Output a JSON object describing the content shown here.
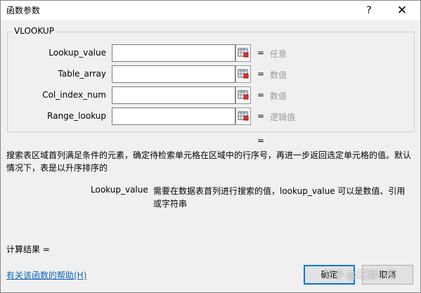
{
  "window": {
    "title": "函数参数",
    "help_label": "?",
    "close_label": "✕"
  },
  "group": {
    "function_name": "VLOOKUP",
    "params": [
      {
        "label": "Lookup_value",
        "value": "",
        "equals": "=",
        "hint": "任意"
      },
      {
        "label": "Table_array",
        "value": "",
        "equals": "=",
        "hint": "数值"
      },
      {
        "label": "Col_index_num",
        "value": "",
        "equals": "=",
        "hint": "数值"
      },
      {
        "label": "Range_lookup",
        "value": "",
        "equals": "=",
        "hint": "逻辑值"
      }
    ]
  },
  "result_equals": "=",
  "description": "搜索表区域首列满足条件的元素，确定待检索单元格在区域中的行序号，再进一步返回选定单元格的值。默认情况下，表是以升序排序的",
  "argument_help": {
    "name": "Lookup_value",
    "text": "需要在数据表首列进行搜索的值，lookup_value 可以是数值、引用或字符串"
  },
  "calc_result_label": "计算结果 =",
  "help_link": "有关该函数的帮助(H)",
  "buttons": {
    "ok": "确定",
    "cancel": "取消"
  },
  "watermark": "知乎 @江湖小乐",
  "icons": {
    "picker": "range-select-icon"
  }
}
